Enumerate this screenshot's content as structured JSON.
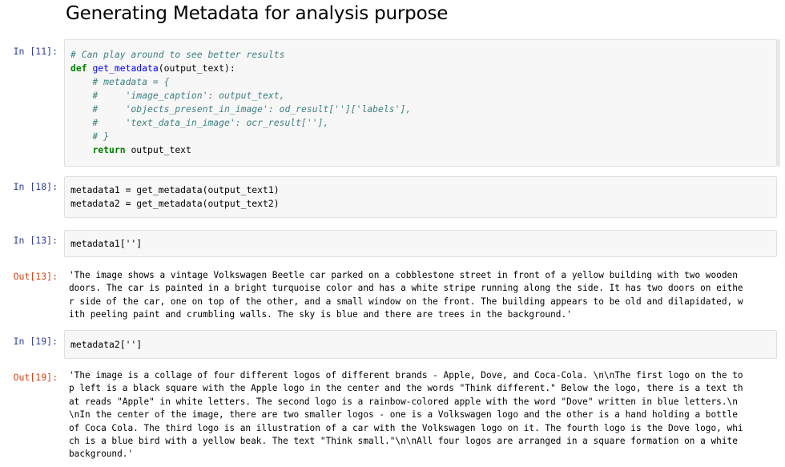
{
  "notebook": {
    "heading": "Generating Metadata for analysis purpose",
    "cells": [
      {
        "prompt": "In [11]:",
        "lines": [
          "# Can play around to see better results",
          "def get_metadata(output_text):",
          "    # metadata = {",
          "    #     'image_caption': output_text,",
          "    #     'objects_present_in_image': od_result['']['labels'],",
          "    #     'text_data_in_image': ocr_result[''],",
          "    # }",
          "    return output_text"
        ]
      },
      {
        "prompt": "In [18]:",
        "lines": [
          "metadata1 = get_metadata(output_text1)",
          "metadata2 = get_metadata(output_text2)"
        ]
      },
      {
        "prompt": "In [13]:",
        "lines": [
          "metadata1['']"
        ]
      },
      {
        "prompt": "Out[13]:",
        "lines": [
          "'The image shows a vintage Volkswagen Beetle car parked on a cobblestone street in front of a yellow building with two wooden",
          "doors. The car is painted in a bright turquoise color and has a white stripe running along the side. It has two doors on eithe",
          "r side of the car, one on top of the other, and a small window on the front. The building appears to be old and dilapidated, w",
          "ith peeling paint and crumbling walls. The sky is blue and there are trees in the background.'"
        ]
      },
      {
        "prompt": "In [19]:",
        "lines": [
          "metadata2['']"
        ]
      },
      {
        "prompt": "Out[19]:",
        "lines": [
          "'The image is a collage of four different logos of different brands - Apple, Dove, and Coca-Cola. \\n\\nThe first logo on the to",
          "p left is a black square with the Apple logo in the center and the words \"Think different.\" Below the logo, there is a text th",
          "at reads \"Apple\" in white letters. The second logo is a rainbow-colored apple with the word \"Dove\" written in blue letters.\\n",
          "\\nIn the center of the image, there are two smaller logos - one is a Volkswagen logo and the other is a hand holding a bottle",
          "of Coca Cola. The third logo is an illustration of a car with the Volkswagen logo on it. The fourth logo is the Dove logo, whi",
          "ch is a blue bird with a yellow beak. The text \"Think small.\"\\n\\nAll four logos are arranged in a square formation on a white",
          "background.'"
        ]
      }
    ]
  }
}
